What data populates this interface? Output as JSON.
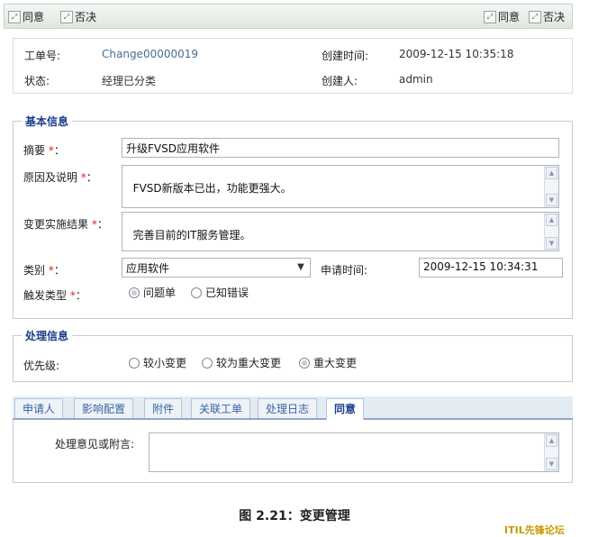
{
  "toolbar": {
    "left_buttons": [
      {
        "label": "同意",
        "icon": "expand-icon"
      },
      {
        "label": "否决",
        "icon": "expand-icon"
      }
    ],
    "right_buttons": [
      {
        "label": "同意",
        "icon": "expand-icon"
      },
      {
        "label": "否决",
        "icon": "expand-icon"
      }
    ]
  },
  "ticket": {
    "number_label": "工单号:",
    "number_value": "Change00000019",
    "status_label": "状态:",
    "status_value": "经理已分类",
    "created_time_label": "创建时间:",
    "created_time_value": "2009-12-15 10:35:18",
    "creator_label": "创建人:",
    "creator_value": "admin"
  },
  "basic_info": {
    "legend": "基本信息",
    "summary_label": "摘要",
    "summary_value": "升级FVSD应用软件",
    "reason_label": "原因及说明",
    "reason_value": "FVSD新版本已出，功能更强大。",
    "result_label": "变更实施结果",
    "result_value": "完善目前的IT服务管理。",
    "category_label": "类别",
    "category_value": "应用软件",
    "apply_time_label": "申请时间:",
    "apply_time_value": "2009-12-15 10:34:31",
    "trigger_label": "触发类型",
    "trigger_options": [
      {
        "label": "问题单",
        "selected": true
      },
      {
        "label": "已知错误",
        "selected": false
      }
    ],
    "required_mark": "*",
    "colon": ":"
  },
  "process_info": {
    "legend": "处理信息",
    "priority_label": "优先级:",
    "priority_options": [
      {
        "label": "较小变更",
        "selected": false
      },
      {
        "label": "较为重大变更",
        "selected": false
      },
      {
        "label": "重大变更",
        "selected": true
      }
    ]
  },
  "tabs": [
    {
      "label": "申请人",
      "active": false
    },
    {
      "label": "影响配置",
      "active": false
    },
    {
      "label": "附件",
      "active": false
    },
    {
      "label": "关联工单",
      "active": false
    },
    {
      "label": "处理日志",
      "active": false
    },
    {
      "label": "同意",
      "active": true
    }
  ],
  "approval": {
    "comment_label": "处理意见或附言:",
    "comment_value": ""
  },
  "caption": "图 2.21：变更管理",
  "watermark": "ITIL先锋论坛",
  "colors": {
    "accent": "#1a3d8a",
    "required": "#e02020",
    "tab_text": "#3a63a0"
  }
}
